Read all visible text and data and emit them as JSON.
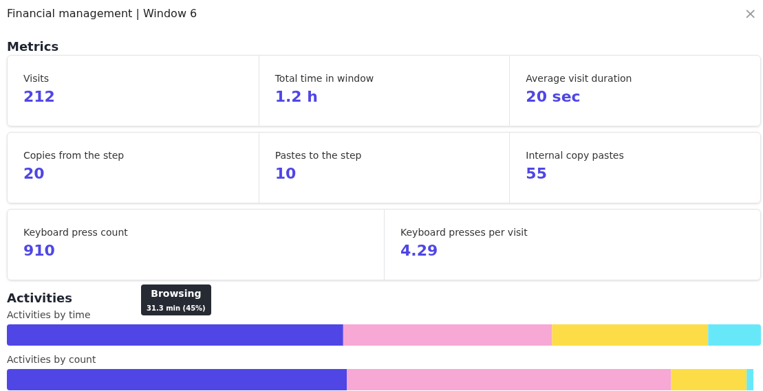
{
  "window": {
    "title": "Financial management | Window 6",
    "close": "×"
  },
  "metrics": {
    "title": "Metrics",
    "groups": [
      {
        "items": [
          {
            "label": "Visits",
            "value": "212"
          },
          {
            "label": "Total time in window",
            "value": "1.2 h"
          },
          {
            "label": "Average visit duration",
            "value": "20 sec"
          }
        ]
      },
      {
        "items": [
          {
            "label": "Copies from the step",
            "value": "20"
          },
          {
            "label": "Pastes to the step",
            "value": "10"
          },
          {
            "label": "Internal copy pastes",
            "value": "55"
          }
        ]
      },
      {
        "items": [
          {
            "label": "Keyboard press count",
            "value": "910"
          },
          {
            "label": "Keyboard presses per visit",
            "value": "4.29"
          }
        ]
      }
    ]
  },
  "activities": {
    "title": "Activities",
    "tooltip": {
      "title": "Browsing",
      "text": "31.3 min (45%)"
    },
    "bars": [
      {
        "label": "Activities by time",
        "segments": [
          {
            "color": "#4f46e5"
          },
          {
            "color": "#f7a8d4"
          },
          {
            "color": "#fcdd47"
          },
          {
            "color": "#67e8f9"
          }
        ]
      },
      {
        "label": "Activities by count",
        "segments": [
          {
            "color": "#4f46e5"
          },
          {
            "color": "#f7a8d4"
          },
          {
            "color": "#fcdd47"
          },
          {
            "color": "#67e8f9"
          }
        ]
      }
    ]
  }
}
